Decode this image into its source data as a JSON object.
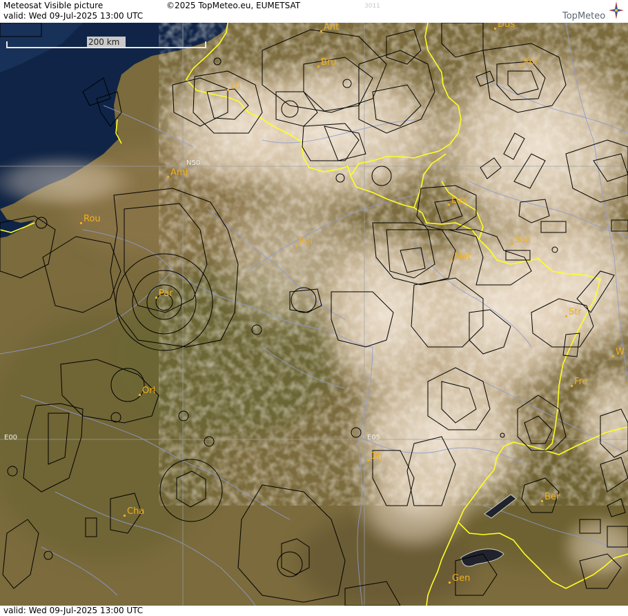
{
  "header": {
    "product": "Meteosat Visible picture",
    "valid": "valid:  Wed  09-Jul-2025  13:00 UTC",
    "copyright": "©2025 TopMeteo.eu, EUMETSAT",
    "code": "3011",
    "brand": "TopMeteo"
  },
  "footer": {
    "valid": "valid:  Wed  09-Jul-2025  13:00 UTC"
  },
  "scale": {
    "label": "200 km"
  },
  "grid_labels": {
    "lat_n50": "N50",
    "lon_e00": "E00",
    "lon_e05": "E05"
  },
  "cities": [
    {
      "name": "Ant"
    },
    {
      "name": "Düs"
    },
    {
      "name": "Bru"
    },
    {
      "name": "Köl"
    },
    {
      "name": "Lil"
    },
    {
      "name": "Ami"
    },
    {
      "name": "Rou"
    },
    {
      "name": "Lux"
    },
    {
      "name": "Rei"
    },
    {
      "name": "Saa"
    },
    {
      "name": "Met"
    },
    {
      "name": "Par"
    },
    {
      "name": "Str"
    },
    {
      "name": "W"
    },
    {
      "name": "Fre"
    },
    {
      "name": "Orl"
    },
    {
      "name": "Dij"
    },
    {
      "name": "Ber"
    },
    {
      "name": "Cha"
    },
    {
      "name": "Gen"
    }
  ],
  "colors": {
    "land": "#7a6a3c",
    "sea": "#0e2344",
    "cloud": "#efe1cf",
    "border": "#ffff22",
    "river": "#8f9bd0",
    "airspace": "#000000",
    "city_label": "#f0b020"
  }
}
